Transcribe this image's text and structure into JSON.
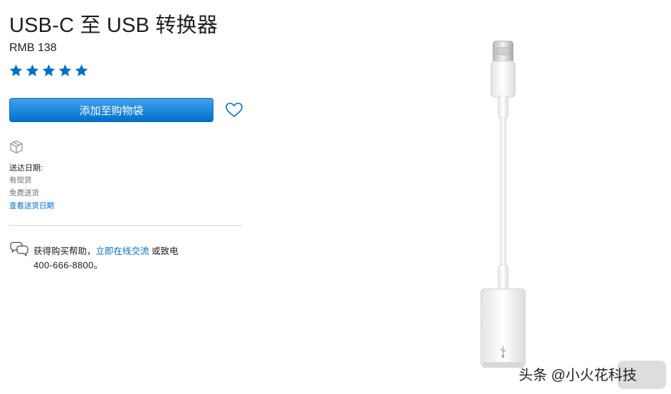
{
  "product": {
    "title": "USB-C 至 USB 转换器",
    "price": "RMB 138",
    "rating": 5,
    "rating_max": 5
  },
  "actions": {
    "add_to_bag": "添加至购物袋"
  },
  "delivery": {
    "label": "送达日期:",
    "stock": "有现货",
    "shipping": "免费送货",
    "link": "查看送货日期"
  },
  "help": {
    "prefix": "获得购买帮助，",
    "chat_link": "立即在线交流",
    "suffix": " 或致电",
    "phone": "400-666-8800。"
  },
  "watermark": {
    "text": "头条 @小火花科技"
  },
  "colors": {
    "accent": "#0070c9",
    "star": "#0070c9",
    "text": "#1d1d1f",
    "secondary_text": "#6e6e73"
  },
  "icons": [
    "star-icon",
    "heart-icon",
    "box-icon",
    "chat-icon",
    "usb-symbol-icon"
  ]
}
